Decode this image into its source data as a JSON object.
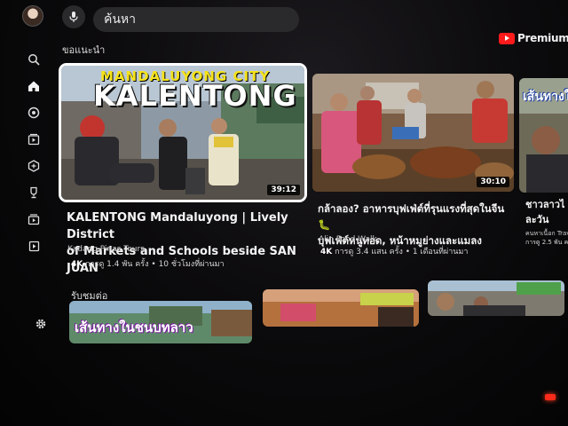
{
  "search": {
    "text": "ค้นหา"
  },
  "brand": {
    "premium_label": "Premium"
  },
  "sidebar": {
    "items": [
      {
        "name": "search-icon"
      },
      {
        "name": "home-icon"
      },
      {
        "name": "shorts-icon"
      },
      {
        "name": "subscriptions-icon"
      },
      {
        "name": "gaming-icon"
      },
      {
        "name": "trophy-icon"
      },
      {
        "name": "library-icon"
      },
      {
        "name": "playlist-icon"
      },
      {
        "name": "gear-icon"
      }
    ]
  },
  "sections": {
    "recommended_title": "ขอแนะนำ",
    "continue_title": "รับชมต่อ"
  },
  "videos": [
    {
      "thumb_text_top": "MANDALUYONG CITY",
      "thumb_text_main": "KALENTONG",
      "duration": "39:12",
      "title_line1": "KALENTONG Mandaluyong | Lively District",
      "title_line2": "of Markets and Schools beside SAN JUAN",
      "channel": "Kadang Pinas Tours",
      "badge": "4K",
      "meta": "การดู 1.4 พัน ครั้ง • 10 ชั่วโมงที่ผ่านมา"
    },
    {
      "duration": "30:10",
      "title_line1": "กล้าลอง? อาหารบุฟเฟ่ต์ที่รุนแรงที่สุดในจีน 🐛",
      "title_line2": "บุฟเฟ่ต์หนูทอด, หน้าหมูย่างและแมลง",
      "channel": "Alin Food Walk",
      "badge": "4K",
      "meta": "การดู 3.4 แสน ครั้ง • 1 เดือนที่ผ่านมา"
    },
    {
      "thumb_text": "เส้นทางใ",
      "title_line1": "ชาวลาวไ",
      "title_line2": "ละวัน",
      "channel": "คนหาเนื้อก Trave",
      "meta": "การดู 2.5 พัน ครั้"
    }
  ],
  "continue_watching": [
    {
      "thumb_text": "เส้นทางในชนบทลาว"
    },
    {
      "thumb_text": ""
    },
    {
      "thumb_text": ""
    }
  ],
  "colors": {
    "brand_red": "#ff1b1b",
    "focus_border": "#ffffff",
    "background": "#050505"
  }
}
